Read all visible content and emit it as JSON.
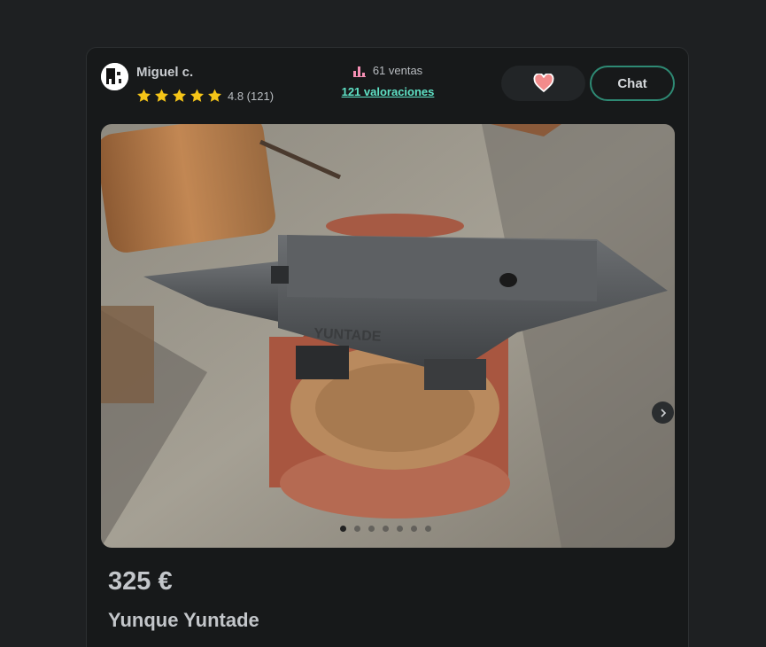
{
  "seller": {
    "name": "Miguel c.",
    "rating_stars": 5,
    "rating_text": "4.8 (121)"
  },
  "stats": {
    "sales": "61 ventas",
    "reviews_link": "121 valoraciones"
  },
  "actions": {
    "chat_label": "Chat",
    "favorite_icon": "heart-icon"
  },
  "gallery": {
    "image_count": 7,
    "active_index": 0,
    "next_icon": "chevron-right-icon"
  },
  "product": {
    "price": "325 €",
    "title": "Yunque Yuntade"
  },
  "colors": {
    "background": "#1e2022",
    "card": "#17191a",
    "accent": "#5fe3c7",
    "chat_border": "#2e8a74",
    "star": "#f5c518",
    "sales_icon": "#f58fb4",
    "heart": "#f28b8b"
  }
}
